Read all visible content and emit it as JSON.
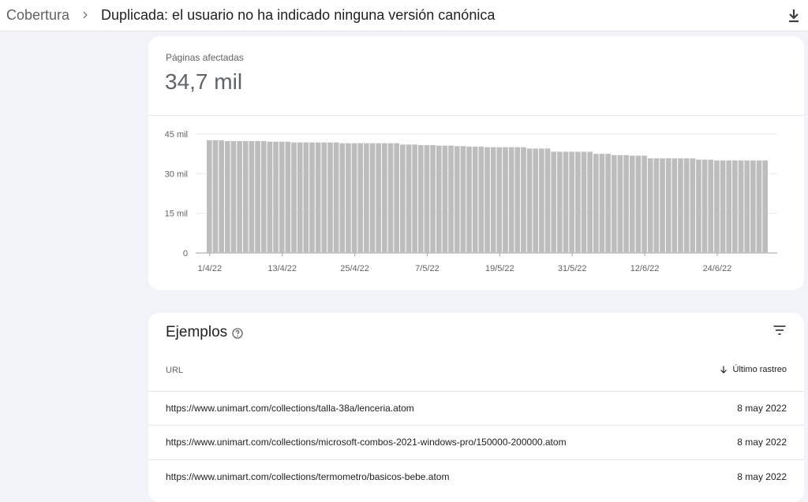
{
  "header": {
    "breadcrumb_root": "Cobertura",
    "breadcrumb_current": "Duplicada: el usuario no ha indicado ninguna versión canónica",
    "download_icon": "download-icon"
  },
  "summary": {
    "metric_label": "Páginas afectadas",
    "metric_value": "34,7 mil"
  },
  "chart_data": {
    "type": "bar",
    "title": "",
    "xlabel": "",
    "ylabel": "",
    "ylim": [
      0,
      45000
    ],
    "ytick_values": [
      0,
      15000,
      30000,
      45000
    ],
    "ytick_labels": [
      "0",
      "15 mil",
      "30 mil",
      "45 mil"
    ],
    "xtick_labels": [
      "1/4/22",
      "13/4/22",
      "25/4/22",
      "7/5/22",
      "19/5/22",
      "31/5/22",
      "12/6/22",
      "24/6/22"
    ],
    "bar_color": "#bdbdbd",
    "grid": true,
    "values": [
      42600,
      42600,
      42600,
      42300,
      42300,
      42300,
      42300,
      42300,
      42300,
      42300,
      42100,
      42100,
      42100,
      42100,
      41800,
      41800,
      41800,
      41800,
      41800,
      41800,
      41800,
      41800,
      41500,
      41500,
      41500,
      41500,
      41500,
      41500,
      41500,
      41500,
      41500,
      41500,
      41000,
      41000,
      41000,
      40800,
      40800,
      40800,
      40600,
      40600,
      40600,
      40400,
      40400,
      40200,
      40200,
      40200,
      40000,
      40000,
      40000,
      40000,
      40000,
      40000,
      40000,
      39500,
      39500,
      39500,
      39500,
      38300,
      38300,
      38300,
      38300,
      38300,
      38300,
      38300,
      37500,
      37500,
      37500,
      37000,
      37000,
      37000,
      36800,
      36800,
      36800,
      35800,
      35800,
      35800,
      35800,
      35800,
      35800,
      35800,
      35800,
      35300,
      35300,
      35300,
      35000,
      35000,
      35000,
      35000,
      35000,
      35000,
      35000,
      35000,
      35000
    ]
  },
  "examples": {
    "title": "Ejemplos",
    "help_icon": "help-icon",
    "filter_icon": "filter-icon",
    "col_url": "URL",
    "col_date": "Último rastreo",
    "rows": [
      {
        "url": "https://www.unimart.com/collections/talla-38a/lenceria.atom",
        "date": "8 may 2022"
      },
      {
        "url": "https://www.unimart.com/collections/microsoft-combos-2021-windows-pro/150000-200000.atom",
        "date": "8 may 2022"
      },
      {
        "url": "https://www.unimart.com/collections/termometro/basicos-bebe.atom",
        "date": "8 may 2022"
      }
    ]
  }
}
